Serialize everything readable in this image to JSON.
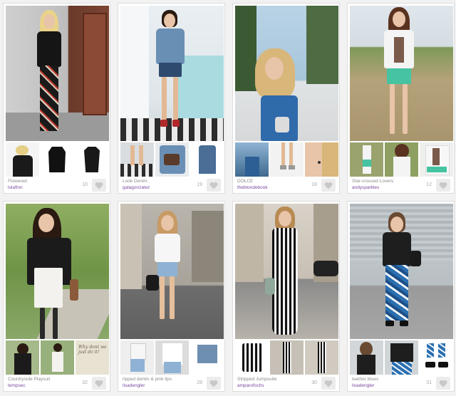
{
  "looks": [
    {
      "title": "Flowered",
      "author": "lolafinn",
      "count": "10"
    },
    {
      "title": "Look Denim",
      "author": "galagonzalez",
      "count": "19"
    },
    {
      "title": "DOLCE",
      "author": "theblondebook",
      "count": "16"
    },
    {
      "title": "Star-crossed Lovers",
      "author": "andysparkles",
      "count": "12"
    },
    {
      "title": "Countryside Playsuit",
      "author": "tempsec",
      "count": "32"
    },
    {
      "title": "ripped denim & pink lips",
      "author": "lisadengler",
      "count": "28"
    },
    {
      "title": "Stripped Jumpsuite",
      "author": "amparofochs",
      "count": "30"
    },
    {
      "title": "leather blues",
      "author": "lisadengler",
      "count": "31"
    }
  ],
  "thumb_text": "Why dont we just do it!",
  "colors": {
    "author": "#7a4aa0",
    "meta": "#8a8a8a",
    "heart": "#c8c8c8"
  }
}
